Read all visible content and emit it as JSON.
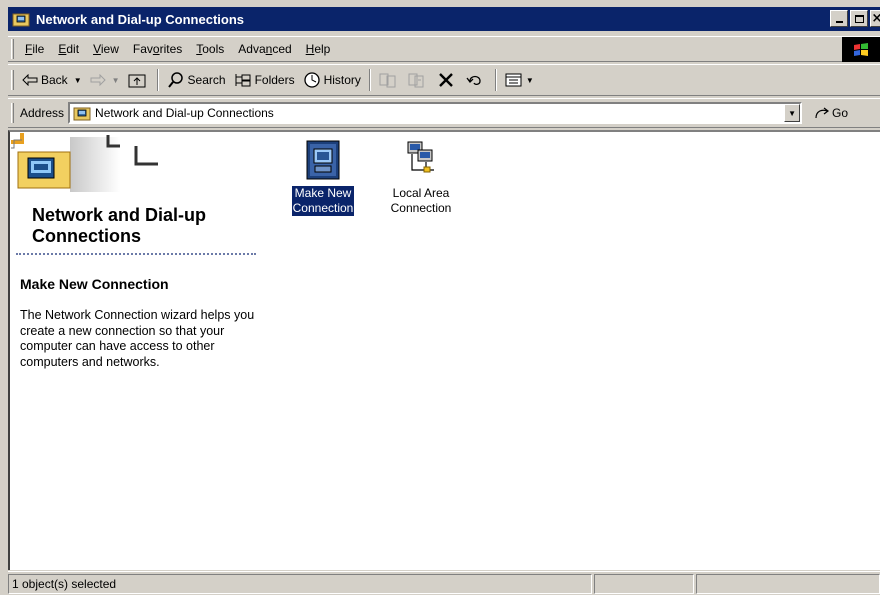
{
  "window": {
    "title": "Network and Dial-up Connections",
    "controls": {
      "minimize": "_",
      "maximize": "□",
      "close": "×"
    }
  },
  "menu": {
    "items": [
      {
        "label": "File",
        "u": "F",
        "rest": "ile"
      },
      {
        "label": "Edit",
        "u": "E",
        "rest": "dit"
      },
      {
        "label": "View",
        "u": "V",
        "rest": "iew"
      },
      {
        "label": "Favorites",
        "pre": "Fav",
        "u": "o",
        "rest": "rites"
      },
      {
        "label": "Tools",
        "u": "T",
        "rest": "ools"
      },
      {
        "label": "Advanced",
        "pre": "Adva",
        "u": "n",
        "rest": "ced"
      },
      {
        "label": "Help",
        "u": "H",
        "rest": "elp"
      }
    ]
  },
  "toolbar": {
    "back_label": "Back",
    "search_label": "Search",
    "folders_label": "Folders",
    "history_label": "History"
  },
  "address": {
    "label": "Address",
    "value": "Network and Dial-up Connections",
    "go_label": "Go"
  },
  "left_pane": {
    "title_line1": "Network and Dial-up",
    "title_line2": "Connections",
    "selected_heading": "Make New Connection",
    "selected_description": "The Network Connection wizard helps you create a new connection so that your computer can have access to other computers and networks."
  },
  "items": [
    {
      "line1": "Make New",
      "line2": "Connection",
      "selected": true,
      "icon": "make-new-connection-icon"
    },
    {
      "line1": "Local Area",
      "line2": "Connection",
      "selected": false,
      "icon": "local-area-connection-icon"
    }
  ],
  "status": {
    "text": "1 object(s) selected"
  }
}
